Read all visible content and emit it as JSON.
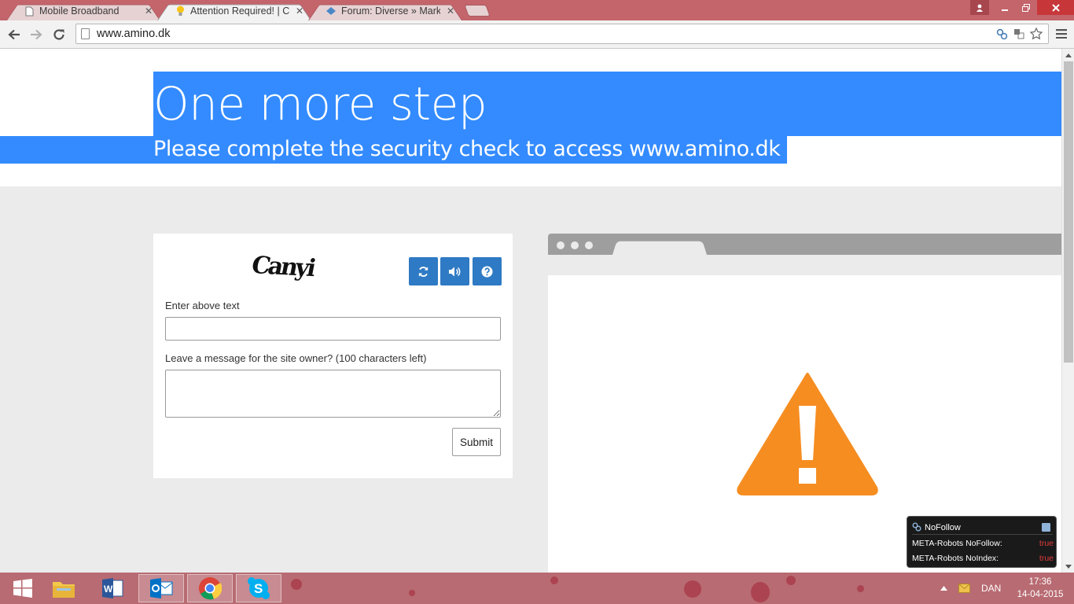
{
  "browser": {
    "tabs": [
      {
        "title": "Mobile Broadband",
        "close": "✕"
      },
      {
        "title": "Attention Required! | Clou",
        "close": "✕"
      },
      {
        "title": "Forum: Diverse » Markete",
        "close": "✕"
      }
    ],
    "url": "www.amino.dk"
  },
  "page": {
    "title": "One more step",
    "subtitle": "Please complete the security check to access www.amino.dk",
    "captcha_text": "Canyi",
    "enter_label": "Enter above text",
    "message_label": "Leave a message for the site owner? (100 characters left)",
    "submit_label": "Submit"
  },
  "nofollow": {
    "title": "NoFollow",
    "rows": [
      {
        "label": "META-Robots NoFollow:",
        "value": "true"
      },
      {
        "label": "META-Robots NoIndex:",
        "value": "true"
      }
    ]
  },
  "taskbar": {
    "language": "DAN",
    "time": "17:36",
    "date": "14-04-2015"
  },
  "colors": {
    "highlight": "#338bff",
    "captcha_button": "#2f7ac4",
    "warning": "#f68d21",
    "titlebar": "#c4646b"
  },
  "icons": {
    "refresh": "refresh-icon",
    "audio": "audio-icon",
    "help": "help-icon",
    "warning": "warning-icon"
  }
}
